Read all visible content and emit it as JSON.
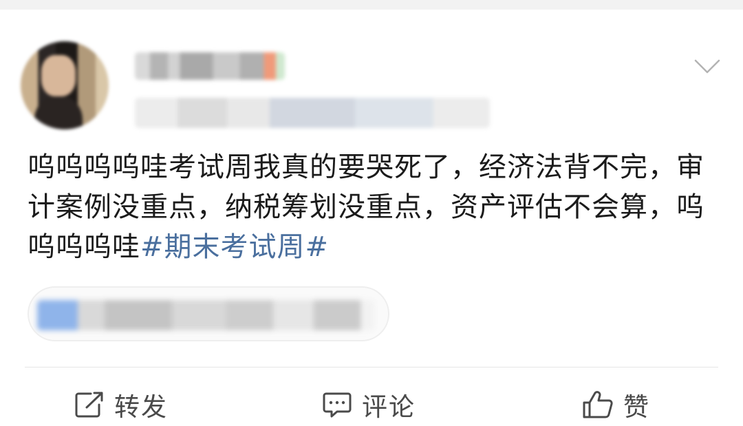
{
  "post": {
    "body_text": "呜呜呜呜哇考试周我真的要哭死了，经济法背不完，审计案例没重点，纳税筹划没重点，资产评估不会算，呜呜呜呜哇",
    "hashtag": "#期末考试周#"
  },
  "actions": {
    "repost_label": "转发",
    "comment_label": "评论",
    "like_label": "赞"
  },
  "icons": {
    "repost": "share-icon",
    "comment": "comment-icon",
    "like": "thumbs-up-icon",
    "menu": "chevron-down-icon"
  },
  "colors": {
    "hashtag": "#4a6f9e",
    "text": "#1b1b1b",
    "action_text": "#4a4a4a"
  }
}
